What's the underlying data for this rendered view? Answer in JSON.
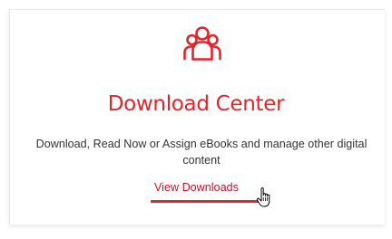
{
  "card": {
    "icon": "users-group-icon",
    "title": "Download Center",
    "description": "Download, Read Now or Assign eBooks and manage other digital content",
    "link_label": "View Downloads"
  },
  "colors": {
    "accent": "#e0252b",
    "text": "#333333",
    "link": "#c8102e"
  },
  "cursor": "hand-pointer-icon"
}
